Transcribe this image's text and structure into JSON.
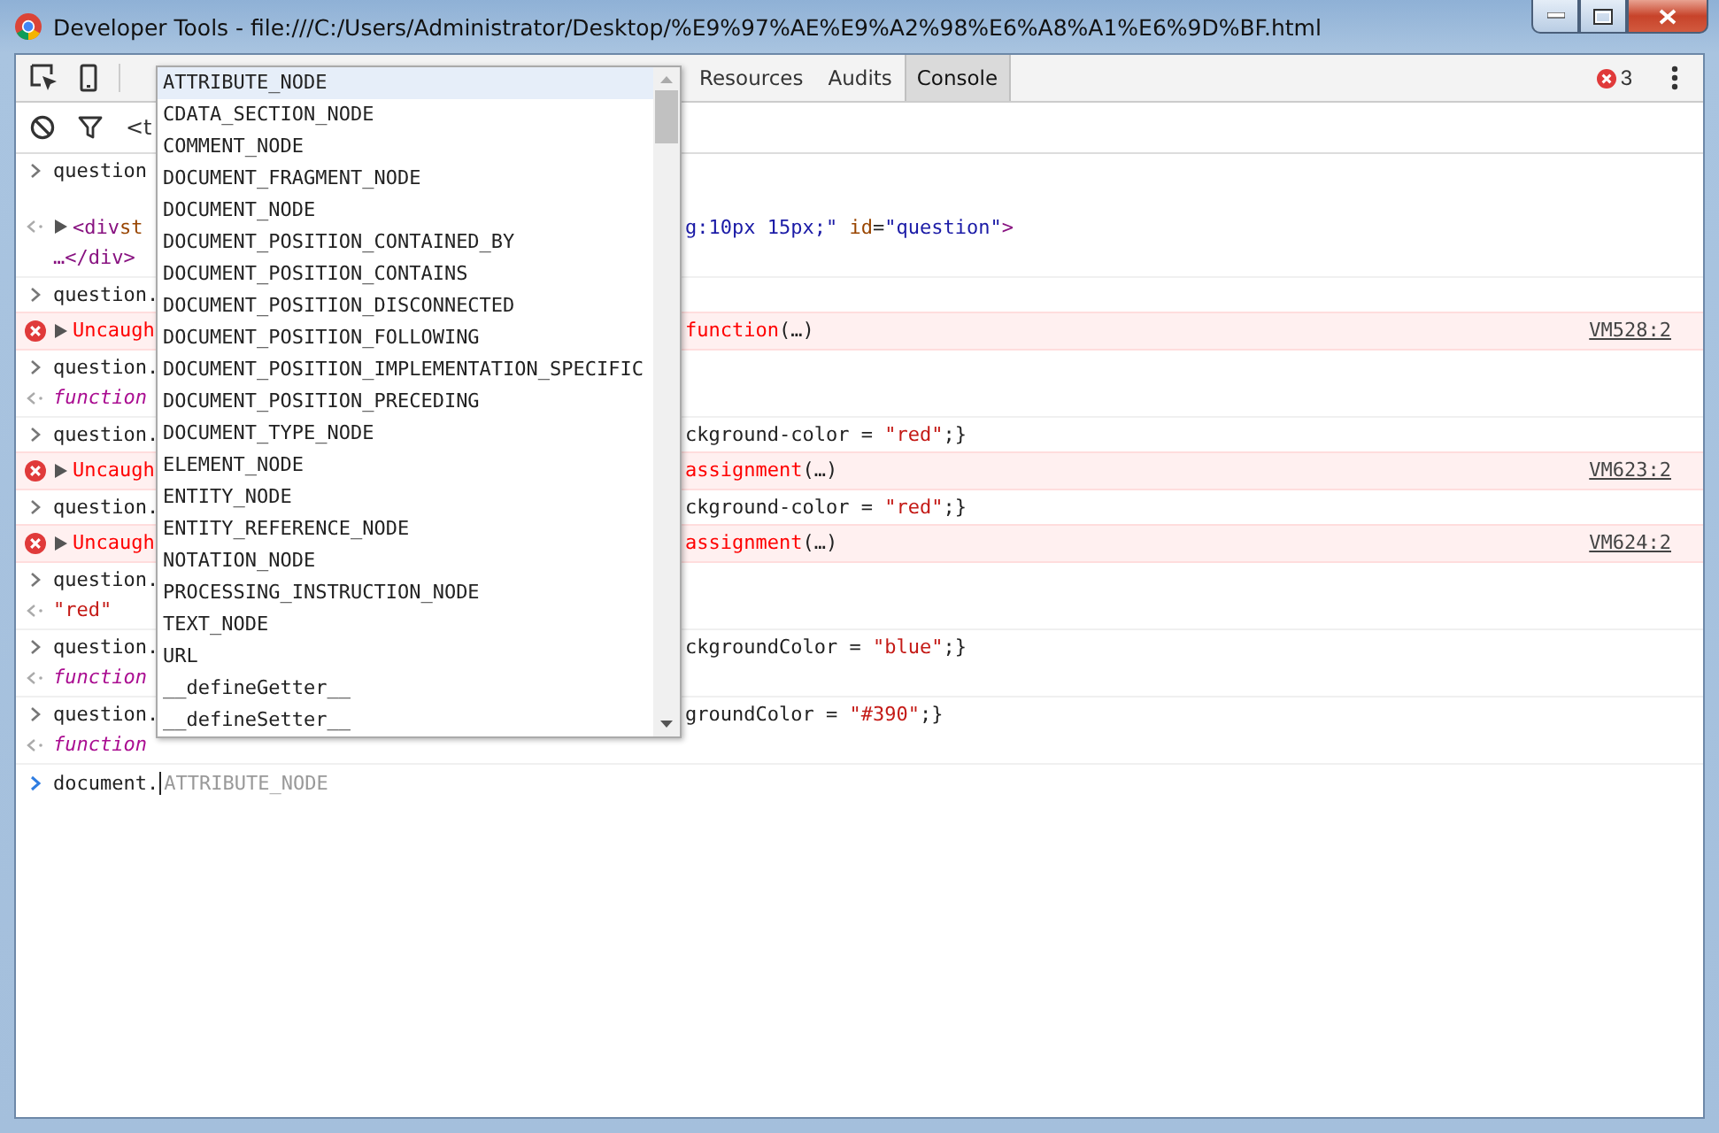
{
  "window": {
    "title": "Developer Tools - file:///C:/Users/Administrator/Desktop/%E9%97%AE%E9%A2%98%E6%A8%A1%E6%9D%BF.html"
  },
  "toolbar": {
    "tabs": [
      {
        "label": "Resources",
        "selected": false
      },
      {
        "label": "Audits",
        "selected": false
      },
      {
        "label": "Console",
        "selected": true
      }
    ],
    "error_count": "3"
  },
  "filter_bar": {
    "context": "<t"
  },
  "console": {
    "groups": [
      {
        "lines": [
          {
            "kind": "input",
            "left": [
              {
                "text": "question",
                "kind": "plain"
              }
            ]
          },
          {
            "kind": "output",
            "expandable": true,
            "left": [
              {
                "text": "<div",
                "kind": "tag"
              },
              {
                "text": " st",
                "kind": "attr"
              }
            ],
            "right": [
              {
                "text": "g:10px 15px;\"",
                "kind": "attrvalue"
              },
              {
                "text": " id",
                "kind": "attr"
              },
              {
                "text": "=",
                "kind": "plain"
              },
              {
                "text": "\"question\"",
                "kind": "attrvalue"
              },
              {
                "text": ">",
                "kind": "tag"
              }
            ]
          },
          {
            "kind": "continuation",
            "left": [
              {
                "text": "…</div>",
                "kind": "tag"
              }
            ]
          }
        ]
      },
      {
        "lines": [
          {
            "kind": "input",
            "left": [
              {
                "text": "question.",
                "kind": "plain"
              }
            ]
          }
        ]
      },
      {
        "lines": [
          {
            "kind": "error",
            "expandable": true,
            "left": [
              {
                "text": "Uncaugh",
                "kind": "error"
              }
            ],
            "right": [
              {
                "text": "function",
                "kind": "error"
              },
              {
                "text": "(…)",
                "kind": "plain"
              }
            ],
            "source": "VM528:2"
          }
        ]
      },
      {
        "lines": [
          {
            "kind": "input",
            "left": [
              {
                "text": "question.",
                "kind": "plain"
              }
            ]
          },
          {
            "kind": "output",
            "left": [
              {
                "text": "function",
                "kind": "keyword"
              }
            ]
          }
        ]
      },
      {
        "lines": [
          {
            "kind": "input",
            "left": [
              {
                "text": "question.",
                "kind": "plain"
              }
            ],
            "right": [
              {
                "text": "ckground-color = ",
                "kind": "plain"
              },
              {
                "text": "\"red\"",
                "kind": "string"
              },
              {
                "text": ";}",
                "kind": "plain"
              }
            ]
          }
        ]
      },
      {
        "lines": [
          {
            "kind": "error",
            "expandable": true,
            "left": [
              {
                "text": "Uncaugh",
                "kind": "error"
              }
            ],
            "right": [
              {
                "text": "assignment",
                "kind": "error"
              },
              {
                "text": "(…)",
                "kind": "plain"
              }
            ],
            "source": "VM623:2"
          }
        ]
      },
      {
        "lines": [
          {
            "kind": "input",
            "left": [
              {
                "text": "question.",
                "kind": "plain"
              }
            ],
            "right": [
              {
                "text": "ckground-color = ",
                "kind": "plain"
              },
              {
                "text": "\"red\"",
                "kind": "string"
              },
              {
                "text": ";}",
                "kind": "plain"
              }
            ]
          }
        ]
      },
      {
        "lines": [
          {
            "kind": "error",
            "expandable": true,
            "left": [
              {
                "text": "Uncaugh",
                "kind": "error"
              }
            ],
            "right": [
              {
                "text": "assignment",
                "kind": "error"
              },
              {
                "text": "(…)",
                "kind": "plain"
              }
            ],
            "source": "VM624:2"
          }
        ]
      },
      {
        "lines": [
          {
            "kind": "input",
            "left": [
              {
                "text": "question.",
                "kind": "plain"
              }
            ]
          },
          {
            "kind": "output",
            "left": [
              {
                "text": "\"red\"",
                "kind": "string"
              }
            ]
          }
        ]
      },
      {
        "lines": [
          {
            "kind": "input",
            "left": [
              {
                "text": "question.",
                "kind": "plain"
              }
            ],
            "right": [
              {
                "text": "ckgroundColor = ",
                "kind": "plain"
              },
              {
                "text": "\"blue\"",
                "kind": "string"
              },
              {
                "text": ";}",
                "kind": "plain"
              }
            ]
          },
          {
            "kind": "output",
            "left": [
              {
                "text": "function",
                "kind": "keyword"
              }
            ]
          }
        ]
      },
      {
        "lines": [
          {
            "kind": "input",
            "left": [
              {
                "text": "question.",
                "kind": "plain"
              }
            ],
            "right": [
              {
                "text": "groundColor = ",
                "kind": "plain"
              },
              {
                "text": "\"#390\"",
                "kind": "string"
              },
              {
                "text": ";}",
                "kind": "plain"
              }
            ]
          },
          {
            "kind": "output",
            "left": [
              {
                "text": "function",
                "kind": "keyword"
              }
            ]
          }
        ]
      }
    ],
    "prompt": {
      "value": "document.",
      "suggestion": "ATTRIBUTE_NODE"
    }
  },
  "autocomplete": {
    "items": [
      {
        "label": "ATTRIBUTE_NODE",
        "selected": true
      },
      {
        "label": "CDATA_SECTION_NODE",
        "selected": false
      },
      {
        "label": "COMMENT_NODE",
        "selected": false
      },
      {
        "label": "DOCUMENT_FRAGMENT_NODE",
        "selected": false
      },
      {
        "label": "DOCUMENT_NODE",
        "selected": false
      },
      {
        "label": "DOCUMENT_POSITION_CONTAINED_BY",
        "selected": false
      },
      {
        "label": "DOCUMENT_POSITION_CONTAINS",
        "selected": false
      },
      {
        "label": "DOCUMENT_POSITION_DISCONNECTED",
        "selected": false
      },
      {
        "label": "DOCUMENT_POSITION_FOLLOWING",
        "selected": false
      },
      {
        "label": "DOCUMENT_POSITION_IMPLEMENTATION_SPECIFIC",
        "selected": false
      },
      {
        "label": "DOCUMENT_POSITION_PRECEDING",
        "selected": false
      },
      {
        "label": "DOCUMENT_TYPE_NODE",
        "selected": false
      },
      {
        "label": "ELEMENT_NODE",
        "selected": false
      },
      {
        "label": "ENTITY_NODE",
        "selected": false
      },
      {
        "label": "ENTITY_REFERENCE_NODE",
        "selected": false
      },
      {
        "label": "NOTATION_NODE",
        "selected": false
      },
      {
        "label": "PROCESSING_INSTRUCTION_NODE",
        "selected": false
      },
      {
        "label": "TEXT_NODE",
        "selected": false
      },
      {
        "label": "URL",
        "selected": false
      },
      {
        "label": "__defineGetter__",
        "selected": false
      },
      {
        "label": "__defineSetter__",
        "selected": false
      }
    ]
  }
}
